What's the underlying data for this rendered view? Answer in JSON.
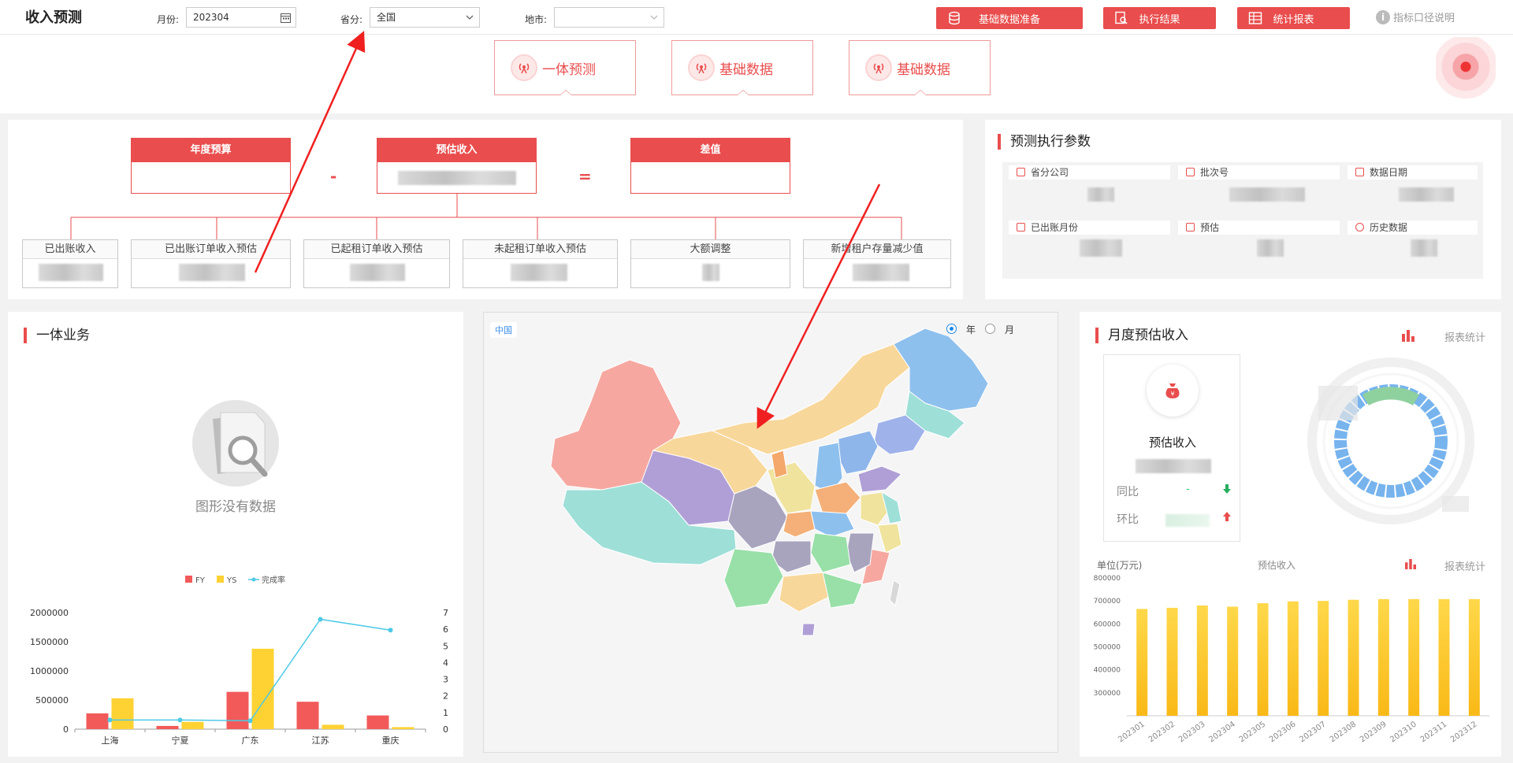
{
  "header": {
    "title": "收入预测",
    "month_label": "月份:",
    "month_value": "202304",
    "province_label": "省分:",
    "province_value": "全国",
    "city_label": "地市:",
    "city_value": "",
    "buttons": [
      "基础数据准备",
      "执行结果",
      "统计报表"
    ],
    "help_label": "指标口径说明"
  },
  "tabs": [
    "一体预测",
    "基础数据",
    "基础数据"
  ],
  "formula": {
    "top": [
      "年度预算",
      "预估收入",
      "差值"
    ],
    "minus": "-",
    "equals": "=",
    "subs": [
      "已出账收入",
      "已出账订单收入预估",
      "已起租订单收入预估",
      "未起租订单收入预估",
      "大额调整",
      "新增租户存量减少值"
    ]
  },
  "params": {
    "title": "预测执行参数",
    "items": [
      "省分公司",
      "批次号",
      "数据日期",
      "已出账月份",
      "预估",
      "历史数据"
    ]
  },
  "business": {
    "title": "一体业务",
    "empty_text": "图形没有数据"
  },
  "map": {
    "label": "中国",
    "radio_year": "年",
    "radio_month": "月",
    "selected": "年"
  },
  "monthly": {
    "title": "月度预估收入",
    "report_link": "报表统计",
    "card_title": "预估收入",
    "yoy_label": "同比",
    "yoy_value": "-",
    "mom_label": "环比",
    "unit_label": "单位(万元)",
    "chart_title": "预估收入",
    "report_link2": "报表统计"
  },
  "colors": {
    "accent": "#e94d4d",
    "fy": "#f25a5a",
    "ys": "#ffd233",
    "rate": "#4dc9e6"
  },
  "chart_data": [
    {
      "type": "bar",
      "categories": [
        "上海",
        "宁夏",
        "广东",
        "江苏",
        "重庆"
      ],
      "series": [
        {
          "name": "FY",
          "type": "bar",
          "axis": "left",
          "values": [
            270000,
            55000,
            640000,
            470000,
            235000
          ]
        },
        {
          "name": "YS",
          "type": "bar",
          "axis": "left",
          "values": [
            530000,
            125000,
            1380000,
            75000,
            35000
          ]
        },
        {
          "name": "完成率",
          "type": "line",
          "axis": "right",
          "values": [
            0.55,
            0.55,
            0.5,
            6.6,
            5.95
          ]
        }
      ],
      "ylim": [
        0,
        2000000
      ],
      "y_ticks": [
        0,
        500000,
        1000000,
        1500000,
        2000000
      ],
      "y2lim": [
        0,
        7
      ],
      "y2_ticks": [
        0,
        1,
        2,
        3,
        4,
        5,
        6,
        7
      ],
      "legend": "top"
    },
    {
      "type": "bar",
      "categories": [
        "202301",
        "202302",
        "202303",
        "202304",
        "202305",
        "202306",
        "202307",
        "202308",
        "202309",
        "202310",
        "202311",
        "202312"
      ],
      "values": [
        665000,
        670000,
        680000,
        675000,
        690000,
        698000,
        700000,
        705000,
        708000,
        708000,
        708000,
        708000
      ],
      "ylim": [
        200000,
        800000
      ],
      "y_ticks": [
        300000,
        400000,
        500000,
        600000,
        700000,
        800000
      ],
      "ylabel": "单位(万元)"
    }
  ]
}
